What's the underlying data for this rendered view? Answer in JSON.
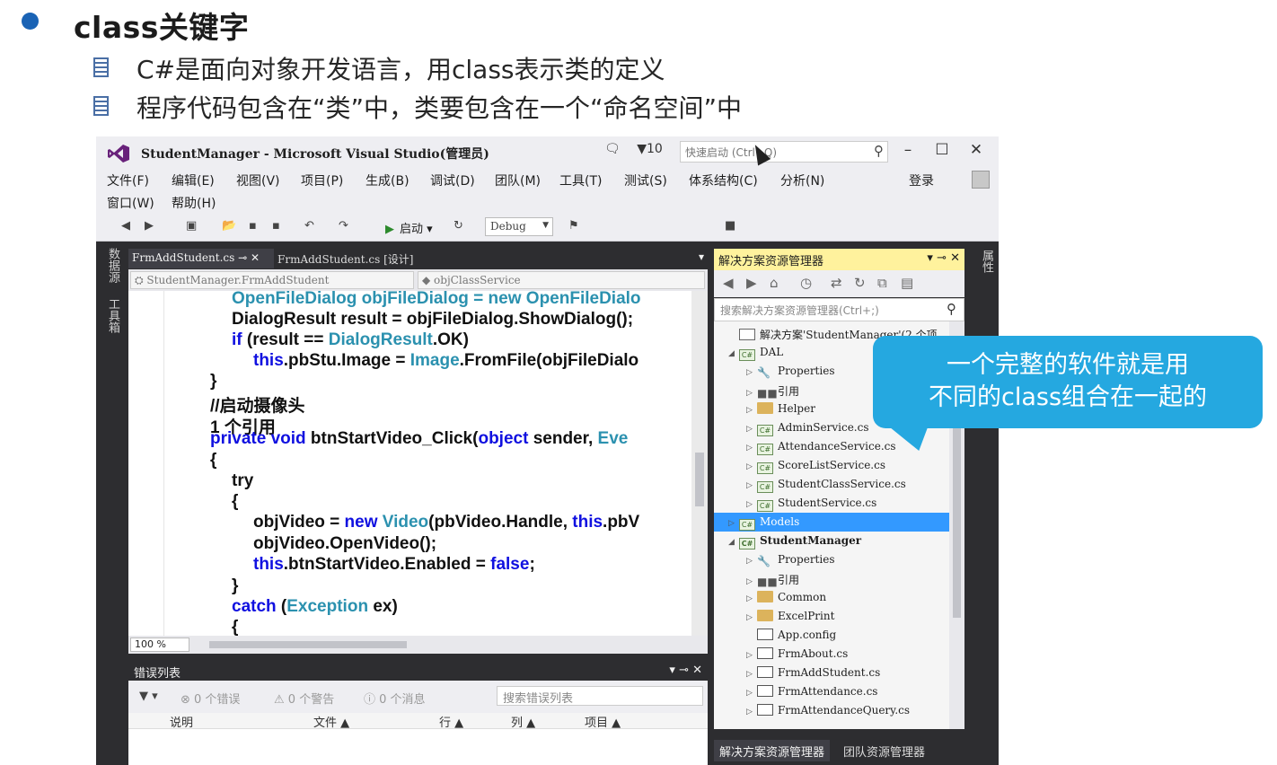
{
  "slide": {
    "title": "class关键字",
    "subpoints": [
      "C#是面向对象开发语言，用class表示类的定义",
      "程序代码包含在“类”中，类要包含在一个“命名空间”中"
    ]
  },
  "vs": {
    "title": "StudentManager - Microsoft Visual Studio(管理员)",
    "notif_count": "▼10",
    "quick_launch": "快速启动 (Ctrl+Q)",
    "menu": [
      "文件(F)",
      "编辑(E)",
      "视图(V)",
      "项目(P)",
      "生成(B)",
      "调试(D)",
      "团队(M)",
      "工具(T)",
      "测试(S)",
      "体系结构(C)",
      "分析(N)",
      "窗口(W)",
      "帮助(H)"
    ],
    "login": "登录",
    "start_label": "启动",
    "config": "Debug",
    "left_strip": [
      "数据源",
      "工具箱"
    ],
    "right_strip": "属性",
    "tabs": [
      "FrmAddStudent.cs",
      "FrmAddStudent.cs [设计]"
    ],
    "nav_left": "StudentManager.FrmAddStudent",
    "nav_right": "objClassService",
    "zoom": "100 %",
    "code": {
      "l1": "OpenFileDialog objFileDialog = new OpenFileDialo",
      "l2": "DialogResult result = objFileDialog.ShowDialog();",
      "l3a": "if",
      "l3b": " (result == ",
      "l3c": "DialogResult",
      "l3d": ".OK)",
      "l4a": "this",
      "l4b": ".pbStu.Image = ",
      "l4c": "Image",
      "l4d": ".FromFile(objFileDialo",
      "l5": "}",
      "l6": "//启动摄像头",
      "l7": "1 个引用",
      "l8a": "private void",
      "l8b": " btnStartVideo_Click(",
      "l8c": "object",
      "l8d": " sender, ",
      "l8e": "Eve",
      "l9": "{",
      "l10": "try",
      "l11": "{",
      "l12a": "objVideo = ",
      "l12b": "new",
      "l12c": " ",
      "l12d": "Video",
      "l12e": "(pbVideo.Handle, ",
      "l12f": "this",
      "l12g": ".pbV",
      "l13": "objVideo.OpenVideo();",
      "l14a": "this",
      "l14b": ".btnStartVideo.Enabled = ",
      "l14c": "false",
      "l14d": ";",
      "l15": "}",
      "l16a": "catch",
      "l16b": " (",
      "l16c": "Exception",
      "l16d": " ex)",
      "l17": "{"
    },
    "error_list": {
      "title": "错误列表",
      "errors": "⊗ 0 个错误",
      "warnings": "⚠ 0 个警告",
      "messages": "ⓘ 0 个消息",
      "search": "搜索错误列表",
      "columns": [
        "说明",
        "文件 ▲",
        "行 ▲",
        "列 ▲",
        "项目 ▲"
      ]
    },
    "solution_explorer": {
      "title": "解决方案资源管理器",
      "search": "搜索解决方案资源管理器(Ctrl+;)",
      "items": [
        {
          "label": "解决方案'StudentManager'(2 个项",
          "arrow": "",
          "icon": "sln"
        },
        {
          "label": "DAL",
          "arrow": "◢",
          "icon": "cs"
        },
        {
          "label": "Properties",
          "arrow": "▷",
          "icon": "wrench"
        },
        {
          "label": "引用",
          "arrow": "▷",
          "icon": "ref"
        },
        {
          "label": "Helper",
          "arrow": "▷",
          "icon": "folder"
        },
        {
          "label": "AdminService.cs",
          "arrow": "▷",
          "icon": "cs"
        },
        {
          "label": "AttendanceService.cs",
          "arrow": "▷",
          "icon": "cs"
        },
        {
          "label": "ScoreListService.cs",
          "arrow": "▷",
          "icon": "cs"
        },
        {
          "label": "StudentClassService.cs",
          "arrow": "▷",
          "icon": "cs"
        },
        {
          "label": "StudentService.cs",
          "arrow": "▷",
          "icon": "cs"
        },
        {
          "label": "Models",
          "arrow": "▷",
          "icon": "cs",
          "selected": true
        },
        {
          "label": "StudentManager",
          "arrow": "◢",
          "icon": "cs",
          "bold": true
        },
        {
          "label": "Properties",
          "arrow": "▷",
          "icon": "wrench"
        },
        {
          "label": "引用",
          "arrow": "▷",
          "icon": "ref"
        },
        {
          "label": "Common",
          "arrow": "▷",
          "icon": "folder"
        },
        {
          "label": "ExcelPrint",
          "arrow": "▷",
          "icon": "folder"
        },
        {
          "label": "App.config",
          "arrow": "",
          "icon": "config"
        },
        {
          "label": "FrmAbout.cs",
          "arrow": "▷",
          "icon": "form"
        },
        {
          "label": "FrmAddStudent.cs",
          "arrow": "▷",
          "icon": "form"
        },
        {
          "label": "FrmAttendance.cs",
          "arrow": "▷",
          "icon": "form"
        },
        {
          "label": "FrmAttendanceQuery.cs",
          "arrow": "▷",
          "icon": "form"
        }
      ],
      "bottom_tabs": [
        "解决方案资源管理器",
        "团队资源管理器"
      ]
    }
  },
  "callout": {
    "line1": "一个完整的软件就是用",
    "line2": "不同的class组合在一起的"
  },
  "colors": {
    "accent": "#25a8e0",
    "selection": "#3399ff",
    "keyword": "#1010e0",
    "type": "#2b91af",
    "comment": "#2a8a2a"
  }
}
